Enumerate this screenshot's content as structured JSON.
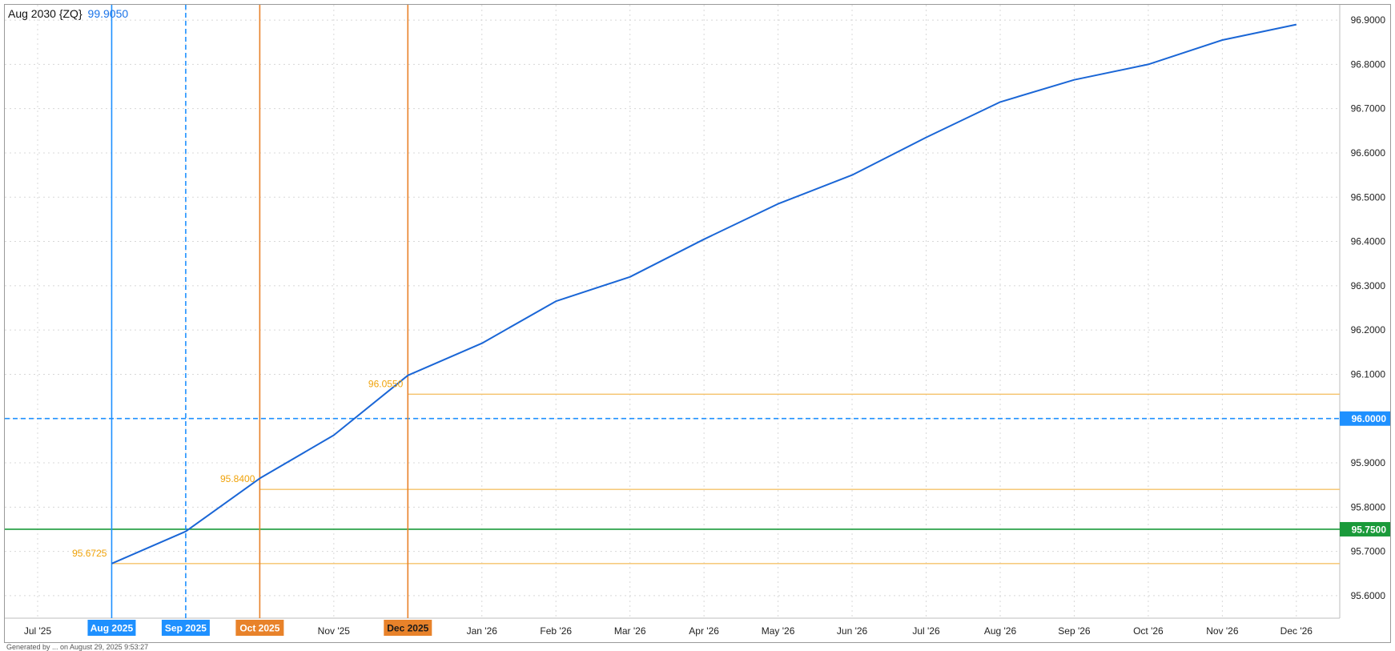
{
  "header": {
    "symbol": "Aug 2030 {ZQ}",
    "last_value": "99.9050"
  },
  "footer": {
    "text": "Generated by ... on August 29, 2025 9:53:27"
  },
  "colors": {
    "line": "#1a66d6",
    "blue_marker": "#1e90ff",
    "orange_marker": "#e8822a",
    "threshold_line": "#f5c26a",
    "threshold_label": "#f0a30a",
    "green_line": "#1a9a3a",
    "grid": "#d8d8d8"
  },
  "chart_data": {
    "type": "line",
    "x_labels": [
      "Jul '25",
      "Aug 2025",
      "Sep 2025",
      "Oct 2025",
      "Nov '25",
      "Dec 2025",
      "Jan '26",
      "Feb '26",
      "Mar '26",
      "Apr '26",
      "May '26",
      "Jun '26",
      "Jul '26",
      "Aug '26",
      "Sep '26",
      "Oct '26",
      "Nov '26",
      "Dec '26"
    ],
    "y_ticks": [
      "95.6000",
      "95.7000",
      "95.8000",
      "95.9000",
      "96.0000",
      "96.1000",
      "96.2000",
      "96.3000",
      "96.4000",
      "96.5000",
      "96.6000",
      "96.7000",
      "96.8000",
      "96.9000"
    ],
    "ylim": [
      95.57,
      96.93
    ],
    "y_axis_position": "right",
    "grid": true,
    "series": [
      {
        "x": [
          "Aug 2025",
          "Sep 2025",
          "Oct 2025",
          "Nov '25",
          "Dec 2025",
          "Jan '26",
          "Feb '26",
          "Mar '26",
          "Apr '26",
          "May '26",
          "Jun '26",
          "Jul '26",
          "Aug '26",
          "Sep '26",
          "Oct '26",
          "Nov '26",
          "Dec '26"
        ],
        "values": [
          95.6725,
          95.745,
          95.865,
          95.9625,
          96.0975,
          96.17,
          96.265,
          96.32,
          96.405,
          96.485,
          96.55,
          96.635,
          96.715,
          96.765,
          96.8,
          96.855,
          96.89
        ]
      }
    ],
    "highlighted_months": [
      {
        "label": "Aug 2025",
        "style": "solid",
        "color": "blue"
      },
      {
        "label": "Sep 2025",
        "style": "dashed",
        "color": "blue"
      },
      {
        "label": "Oct 2025",
        "style": "solid",
        "color": "orange"
      },
      {
        "label": "Dec 2025",
        "style": "solid",
        "color": "orange"
      }
    ],
    "threshold_levels": [
      {
        "from": "Aug 2025",
        "value": 95.6725,
        "label": "95.6725"
      },
      {
        "from": "Oct 2025",
        "value": 95.84,
        "label": "95.8400"
      },
      {
        "from": "Dec 2025",
        "value": 96.055,
        "label": "96.0550"
      }
    ],
    "horizontal_lines": [
      {
        "value": 96.0,
        "label": "96.0000",
        "style": "dashed",
        "color": "blue"
      },
      {
        "value": 95.75,
        "label": "95.7500",
        "style": "solid",
        "color": "green"
      }
    ]
  }
}
